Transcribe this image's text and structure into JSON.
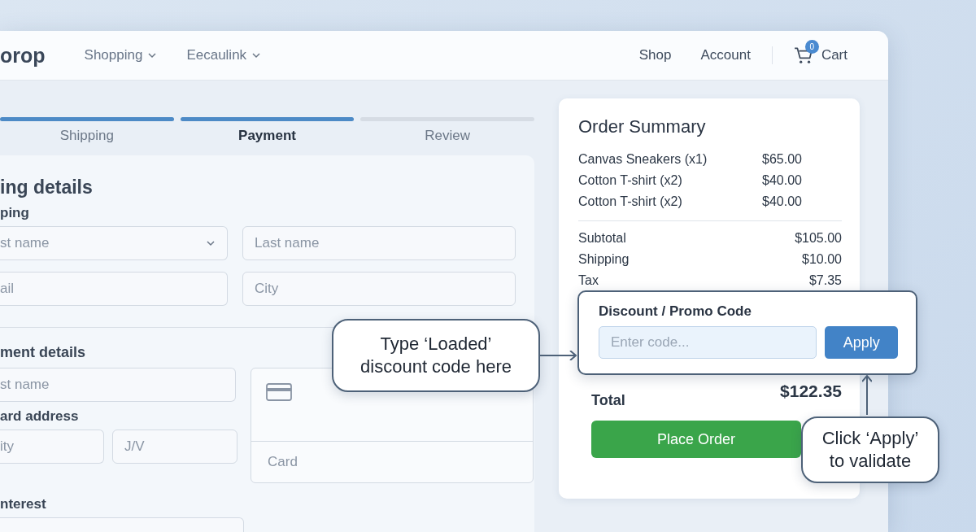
{
  "nav": {
    "logo": "orop",
    "menus": [
      {
        "label": "Shopping"
      },
      {
        "label": "Eecaulink"
      }
    ],
    "links": [
      {
        "label": "Shop"
      },
      {
        "label": "Account"
      }
    ],
    "cart": {
      "label": "Cart",
      "count": "0"
    }
  },
  "steps": [
    {
      "label": "Shipping",
      "selected": false,
      "completed": true
    },
    {
      "label": "Payment",
      "selected": true,
      "completed": true
    },
    {
      "label": "Review",
      "selected": false,
      "completed": false
    }
  ],
  "form": {
    "heading": "ing details",
    "shipping_label": "ping",
    "shipping_fields": [
      {
        "placeholder": "st name",
        "kind": "select"
      },
      {
        "placeholder": "Last name",
        "kind": "input"
      },
      {
        "placeholder": "ail",
        "kind": "input"
      },
      {
        "placeholder": "City",
        "kind": "input"
      }
    ],
    "payment_heading": "ment details",
    "payment_name": {
      "placeholder": "st name"
    },
    "address_label": "ard address",
    "address_fields": [
      {
        "placeholder": "ity"
      },
      {
        "placeholder": "J/V"
      }
    ],
    "card_field": {
      "placeholder": "Card"
    },
    "interest_label": "nterest"
  },
  "summary": {
    "title": "Order Summary",
    "items": [
      {
        "name": "Canvas Sneakers (x1)",
        "price": "$65.00"
      },
      {
        "name": "Cotton T-shirt (x2)",
        "price": "$40.00"
      },
      {
        "name": "Cotton T-shirt (x2)",
        "price": "$40.00"
      }
    ],
    "totals": [
      {
        "label": "Subtotal",
        "value": "$105.00"
      },
      {
        "label": "Shipping",
        "value": "$10.00"
      },
      {
        "label": "Tax",
        "value": "$7.35"
      }
    ],
    "promo": {
      "label": "Discount / Promo Code",
      "placeholder": "Enter code...",
      "button": "Apply"
    },
    "total": {
      "label": "Total",
      "value": "$122.35"
    },
    "place_order": "Place Order"
  },
  "callouts": [
    {
      "text": "Type ‘Loaded’ discount code here"
    },
    {
      "text": "Click ‘Apply’ to validate"
    }
  ]
}
